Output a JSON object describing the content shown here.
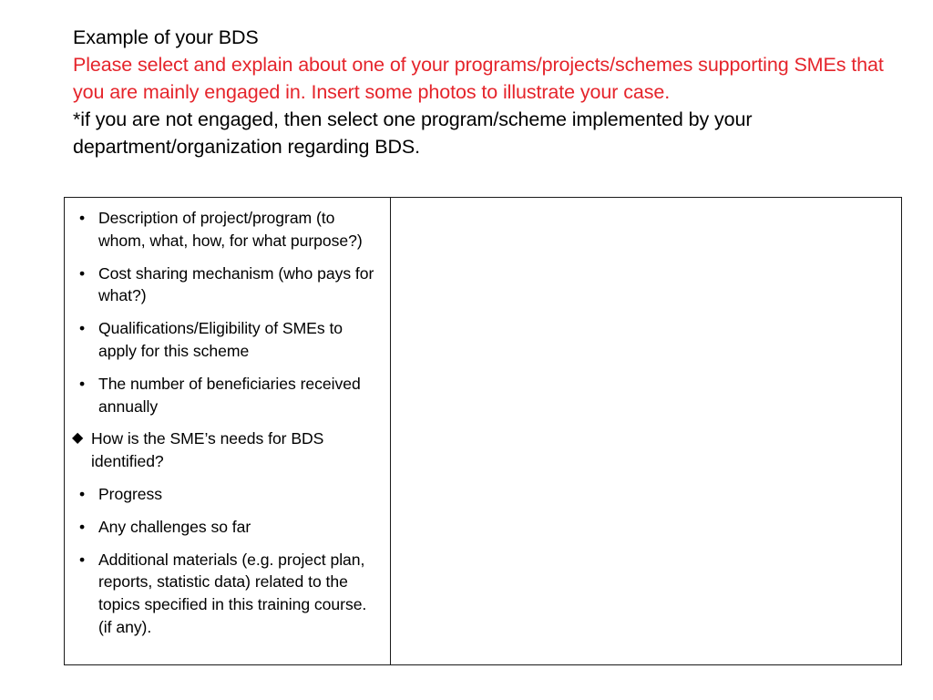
{
  "slide": {
    "title": "Example of your BDS",
    "instruction_red": "Please select and explain about one of your programs/projects/schemes supporting SMEs that you are mainly engaged in. Insert some photos to illustrate your case.",
    "note_black": "*if you are not engaged, then select one program/scheme implemented by your department/organization regarding BDS.",
    "accent_color": "#E5242B",
    "text_color": "#000000",
    "border_color": "#1a1a1a",
    "background_color": "#FFFFFF"
  },
  "table": {
    "left_cell": {
      "items": [
        {
          "marker": "bullet-dot-icon",
          "glyph": "•",
          "text": "Description of project/program (to whom, what, how, for what purpose?)"
        },
        {
          "marker": "bullet-dot-icon",
          "glyph": "•",
          "text": "Cost sharing mechanism (who pays for what?)"
        },
        {
          "marker": "bullet-dot-icon",
          "glyph": "•",
          "text": "Qualifications/Eligibility of SMEs to apply for this scheme"
        },
        {
          "marker": "bullet-dot-icon",
          "glyph": "•",
          "text": "The number of beneficiaries received annually"
        },
        {
          "marker": "bullet-diamond-icon",
          "glyph": "◆",
          "text": "How is the SME’s needs for BDS identified?"
        },
        {
          "marker": "bullet-dot-icon",
          "glyph": "•",
          "text": "Progress"
        },
        {
          "marker": "bullet-dot-icon",
          "glyph": "•",
          "text": "Any challenges so far"
        },
        {
          "marker": "bullet-dot-icon",
          "glyph": "•",
          "text": "Additional materials (e.g. project plan, reports, statistic data) related to the topics specified in this training course. (if any)."
        }
      ]
    },
    "right_cell": {
      "content": ""
    }
  }
}
